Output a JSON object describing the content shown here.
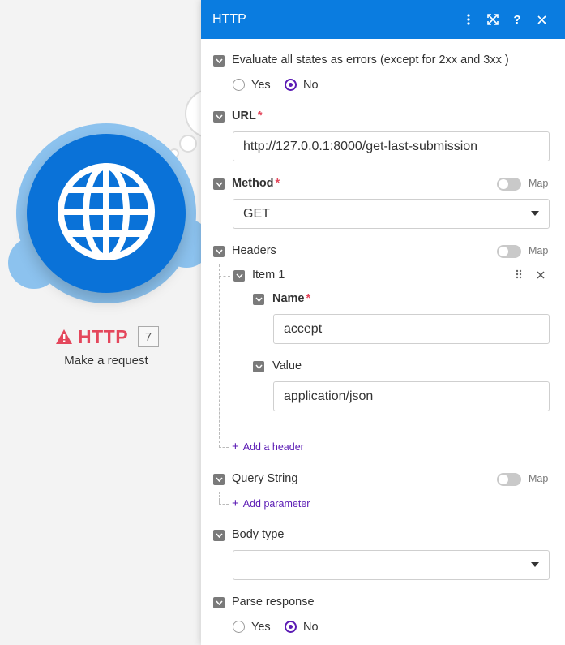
{
  "node": {
    "title": "HTTP",
    "count": "7",
    "subtitle": "Make a request"
  },
  "panel": {
    "title": "HTTP",
    "header_icons": [
      "more-vertical-icon",
      "expand-icon",
      "help-icon",
      "close-icon"
    ],
    "evaluate_errors": {
      "label": "Evaluate all states as errors (except for 2xx and 3xx )",
      "options": [
        "Yes",
        "No"
      ],
      "selected": "No"
    },
    "url": {
      "label": "URL",
      "required_mark": "*",
      "value": "http://127.0.0.1:8000/get-last-submission"
    },
    "method": {
      "label": "Method",
      "required_mark": "*",
      "map_label": "Map",
      "value": "GET"
    },
    "headers": {
      "label": "Headers",
      "map_label": "Map",
      "items": [
        {
          "title": "Item 1",
          "name_label": "Name",
          "name_required": "*",
          "name_value": "accept",
          "value_label": "Value",
          "value_value": "application/json"
        }
      ],
      "add_label": "Add a header"
    },
    "query_string": {
      "label": "Query String",
      "map_label": "Map",
      "add_label": "Add parameter"
    },
    "body_type": {
      "label": "Body type",
      "value": ""
    },
    "parse_response": {
      "label": "Parse response",
      "options": [
        "Yes",
        "No"
      ],
      "selected": "No"
    }
  },
  "colors": {
    "header_blue": "#0a7ce0",
    "node_blue": "#0a72d8",
    "accent_purple": "#5b1bb4",
    "error_red": "#e4475c"
  }
}
